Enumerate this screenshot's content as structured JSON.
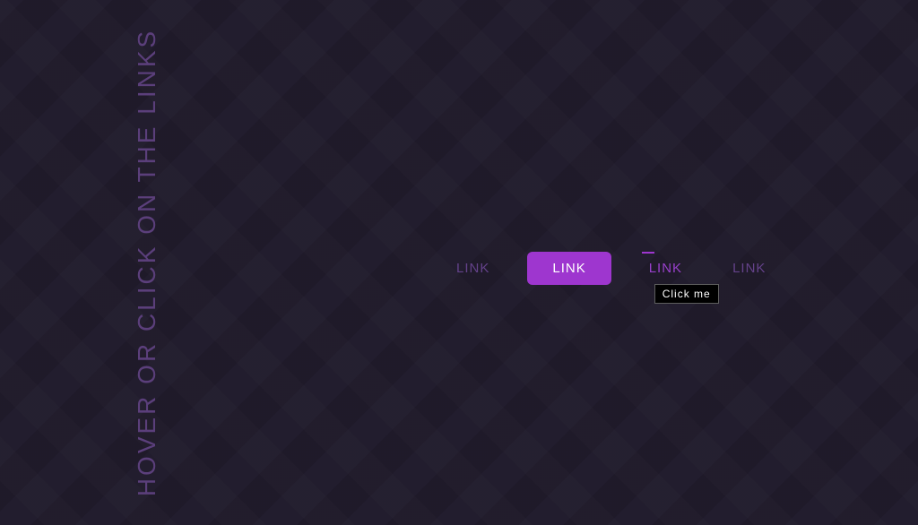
{
  "heading": "HOVER OR CLICK ON THE LINKS",
  "links": [
    {
      "label": "LINK"
    },
    {
      "label": "LINK"
    },
    {
      "label": "LINK"
    },
    {
      "label": "LINK"
    }
  ],
  "tooltip_text": "Click me"
}
